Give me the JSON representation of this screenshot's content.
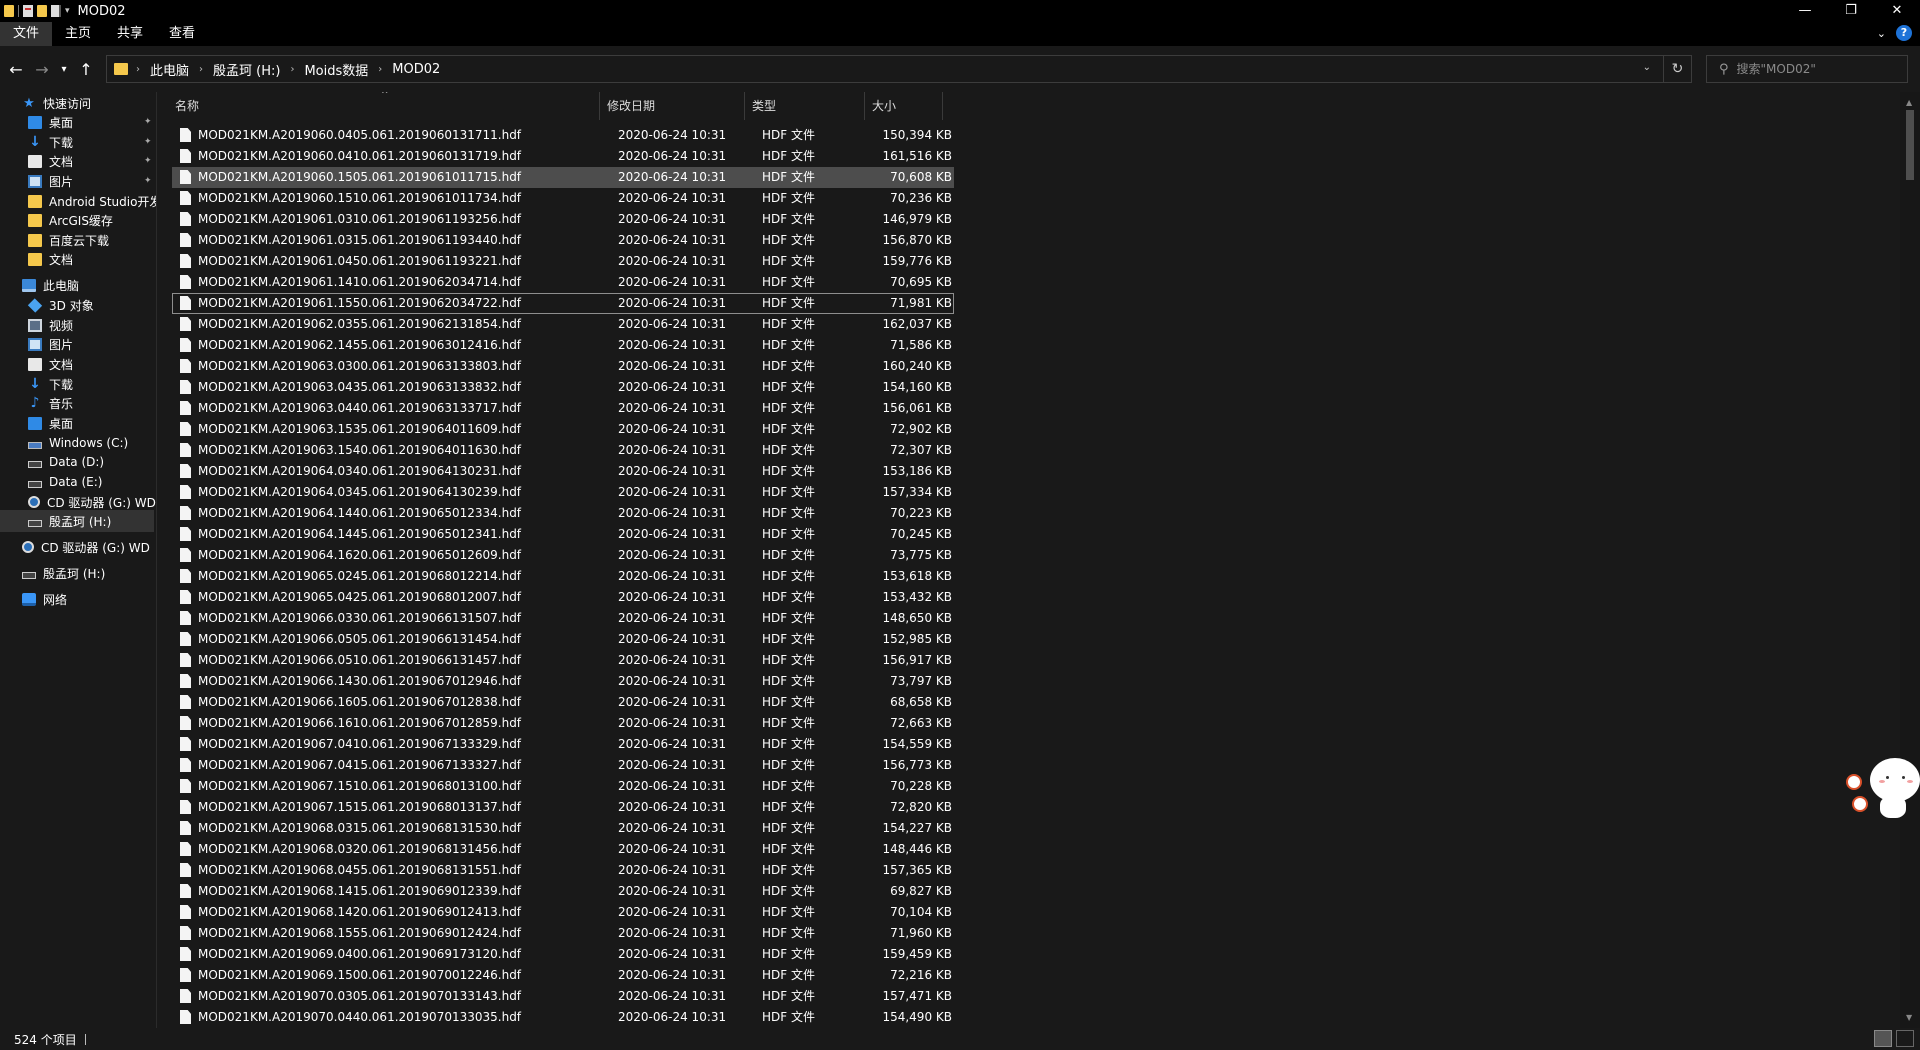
{
  "window": {
    "title": "MOD02",
    "controls": {
      "minimize": "—",
      "maximize": "❐",
      "close": "✕"
    }
  },
  "ribbon": {
    "tabs": [
      "文件",
      "主页",
      "共享",
      "查看"
    ],
    "expand_icon": "chevron-down-icon",
    "help_label": "?"
  },
  "address": {
    "crumbs": [
      "此电脑",
      "殷孟珂 (H:)",
      "Moids数据",
      "MOD02"
    ],
    "separator": "›",
    "search_placeholder": "搜索\"MOD02\""
  },
  "sidebar": {
    "items": [
      {
        "label": "快速访问",
        "icon": "star-icon",
        "indent": 1,
        "pinned": false
      },
      {
        "label": "桌面",
        "icon": "desktop-icon",
        "indent": 2,
        "pinned": true
      },
      {
        "label": "下载",
        "icon": "download-icon",
        "indent": 2,
        "pinned": true
      },
      {
        "label": "文档",
        "icon": "document-icon",
        "indent": 2,
        "pinned": true
      },
      {
        "label": "图片",
        "icon": "pictures-icon",
        "indent": 2,
        "pinned": true
      },
      {
        "label": "Android Studio开发",
        "icon": "folder-icon",
        "indent": 2,
        "pinned": false
      },
      {
        "label": "ArcGIS缓存",
        "icon": "folder-icon",
        "indent": 2,
        "pinned": false
      },
      {
        "label": "百度云下载",
        "icon": "folder-icon",
        "indent": 2,
        "pinned": false
      },
      {
        "label": "文档",
        "icon": "folder-icon",
        "indent": 2,
        "pinned": false
      },
      {
        "label": "此电脑",
        "icon": "computer-icon",
        "indent": 1,
        "pinned": false
      },
      {
        "label": "3D 对象",
        "icon": "3d-objects-icon",
        "indent": 2,
        "pinned": false
      },
      {
        "label": "视频",
        "icon": "video-icon",
        "indent": 2,
        "pinned": false
      },
      {
        "label": "图片",
        "icon": "pictures-icon",
        "indent": 2,
        "pinned": false
      },
      {
        "label": "文档",
        "icon": "document-icon",
        "indent": 2,
        "pinned": false
      },
      {
        "label": "下载",
        "icon": "download-icon",
        "indent": 2,
        "pinned": false
      },
      {
        "label": "音乐",
        "icon": "music-icon",
        "indent": 2,
        "pinned": false
      },
      {
        "label": "桌面",
        "icon": "desktop-icon",
        "indent": 2,
        "pinned": false
      },
      {
        "label": "Windows (C:)",
        "icon": "windows-drive-icon",
        "indent": 2,
        "pinned": false
      },
      {
        "label": "Data (D:)",
        "icon": "drive-icon",
        "indent": 2,
        "pinned": false
      },
      {
        "label": "Data (E:)",
        "icon": "drive-icon",
        "indent": 2,
        "pinned": false
      },
      {
        "label": "CD 驱动器 (G:) WD",
        "icon": "cd-drive-icon",
        "indent": 2,
        "pinned": false
      },
      {
        "label": "殷孟珂 (H:)",
        "icon": "drive-icon",
        "indent": 2,
        "pinned": false,
        "selected": true
      },
      {
        "label": "CD 驱动器 (G:) WD",
        "icon": "cd-drive-icon",
        "indent": 1,
        "pinned": false
      },
      {
        "label": "殷孟珂 (H:)",
        "icon": "drive-icon",
        "indent": 1,
        "pinned": false
      },
      {
        "label": "网络",
        "icon": "network-icon",
        "indent": 1,
        "pinned": false
      }
    ]
  },
  "columns": {
    "name": "名称",
    "date": "修改日期",
    "type": "类型",
    "size": "大小"
  },
  "files": [
    {
      "name": "MOD021KM.A2019060.0405.061.2019060131711.hdf",
      "date": "2020-06-24 10:31",
      "type": "HDF 文件",
      "size": "150,394 KB"
    },
    {
      "name": "MOD021KM.A2019060.0410.061.2019060131719.hdf",
      "date": "2020-06-24 10:31",
      "type": "HDF 文件",
      "size": "161,516 KB"
    },
    {
      "name": "MOD021KM.A2019060.1505.061.2019061011715.hdf",
      "date": "2020-06-24 10:31",
      "type": "HDF 文件",
      "size": "70,608 KB",
      "selected": true
    },
    {
      "name": "MOD021KM.A2019060.1510.061.2019061011734.hdf",
      "date": "2020-06-24 10:31",
      "type": "HDF 文件",
      "size": "70,236 KB"
    },
    {
      "name": "MOD021KM.A2019061.0310.061.2019061193256.hdf",
      "date": "2020-06-24 10:31",
      "type": "HDF 文件",
      "size": "146,979 KB"
    },
    {
      "name": "MOD021KM.A2019061.0315.061.2019061193440.hdf",
      "date": "2020-06-24 10:31",
      "type": "HDF 文件",
      "size": "156,870 KB"
    },
    {
      "name": "MOD021KM.A2019061.0450.061.2019061193221.hdf",
      "date": "2020-06-24 10:31",
      "type": "HDF 文件",
      "size": "159,776 KB"
    },
    {
      "name": "MOD021KM.A2019061.1410.061.2019062034714.hdf",
      "date": "2020-06-24 10:31",
      "type": "HDF 文件",
      "size": "70,695 KB"
    },
    {
      "name": "MOD021KM.A2019061.1550.061.2019062034722.hdf",
      "date": "2020-06-24 10:31",
      "type": "HDF 文件",
      "size": "71,981 KB",
      "focused": true
    },
    {
      "name": "MOD021KM.A2019062.0355.061.2019062131854.hdf",
      "date": "2020-06-24 10:31",
      "type": "HDF 文件",
      "size": "162,037 KB"
    },
    {
      "name": "MOD021KM.A2019062.1455.061.2019063012416.hdf",
      "date": "2020-06-24 10:31",
      "type": "HDF 文件",
      "size": "71,586 KB"
    },
    {
      "name": "MOD021KM.A2019063.0300.061.2019063133803.hdf",
      "date": "2020-06-24 10:31",
      "type": "HDF 文件",
      "size": "160,240 KB"
    },
    {
      "name": "MOD021KM.A2019063.0435.061.2019063133832.hdf",
      "date": "2020-06-24 10:31",
      "type": "HDF 文件",
      "size": "154,160 KB"
    },
    {
      "name": "MOD021KM.A2019063.0440.061.2019063133717.hdf",
      "date": "2020-06-24 10:31",
      "type": "HDF 文件",
      "size": "156,061 KB"
    },
    {
      "name": "MOD021KM.A2019063.1535.061.2019064011609.hdf",
      "date": "2020-06-24 10:31",
      "type": "HDF 文件",
      "size": "72,902 KB"
    },
    {
      "name": "MOD021KM.A2019063.1540.061.2019064011630.hdf",
      "date": "2020-06-24 10:31",
      "type": "HDF 文件",
      "size": "72,307 KB"
    },
    {
      "name": "MOD021KM.A2019064.0340.061.2019064130231.hdf",
      "date": "2020-06-24 10:31",
      "type": "HDF 文件",
      "size": "153,186 KB"
    },
    {
      "name": "MOD021KM.A2019064.0345.061.2019064130239.hdf",
      "date": "2020-06-24 10:31",
      "type": "HDF 文件",
      "size": "157,334 KB"
    },
    {
      "name": "MOD021KM.A2019064.1440.061.2019065012334.hdf",
      "date": "2020-06-24 10:31",
      "type": "HDF 文件",
      "size": "70,223 KB"
    },
    {
      "name": "MOD021KM.A2019064.1445.061.2019065012341.hdf",
      "date": "2020-06-24 10:31",
      "type": "HDF 文件",
      "size": "70,245 KB"
    },
    {
      "name": "MOD021KM.A2019064.1620.061.2019065012609.hdf",
      "date": "2020-06-24 10:31",
      "type": "HDF 文件",
      "size": "73,775 KB"
    },
    {
      "name": "MOD021KM.A2019065.0245.061.2019068012214.hdf",
      "date": "2020-06-24 10:31",
      "type": "HDF 文件",
      "size": "153,618 KB"
    },
    {
      "name": "MOD021KM.A2019065.0425.061.2019068012007.hdf",
      "date": "2020-06-24 10:31",
      "type": "HDF 文件",
      "size": "153,432 KB"
    },
    {
      "name": "MOD021KM.A2019066.0330.061.2019066131507.hdf",
      "date": "2020-06-24 10:31",
      "type": "HDF 文件",
      "size": "148,650 KB"
    },
    {
      "name": "MOD021KM.A2019066.0505.061.2019066131454.hdf",
      "date": "2020-06-24 10:31",
      "type": "HDF 文件",
      "size": "152,985 KB"
    },
    {
      "name": "MOD021KM.A2019066.0510.061.2019066131457.hdf",
      "date": "2020-06-24 10:31",
      "type": "HDF 文件",
      "size": "156,917 KB"
    },
    {
      "name": "MOD021KM.A2019066.1430.061.2019067012946.hdf",
      "date": "2020-06-24 10:31",
      "type": "HDF 文件",
      "size": "73,797 KB"
    },
    {
      "name": "MOD021KM.A2019066.1605.061.2019067012838.hdf",
      "date": "2020-06-24 10:31",
      "type": "HDF 文件",
      "size": "68,658 KB"
    },
    {
      "name": "MOD021KM.A2019066.1610.061.2019067012859.hdf",
      "date": "2020-06-24 10:31",
      "type": "HDF 文件",
      "size": "72,663 KB"
    },
    {
      "name": "MOD021KM.A2019067.0410.061.2019067133329.hdf",
      "date": "2020-06-24 10:31",
      "type": "HDF 文件",
      "size": "154,559 KB"
    },
    {
      "name": "MOD021KM.A2019067.0415.061.2019067133327.hdf",
      "date": "2020-06-24 10:31",
      "type": "HDF 文件",
      "size": "156,773 KB"
    },
    {
      "name": "MOD021KM.A2019067.1510.061.2019068013100.hdf",
      "date": "2020-06-24 10:31",
      "type": "HDF 文件",
      "size": "70,228 KB"
    },
    {
      "name": "MOD021KM.A2019067.1515.061.2019068013137.hdf",
      "date": "2020-06-24 10:31",
      "type": "HDF 文件",
      "size": "72,820 KB"
    },
    {
      "name": "MOD021KM.A2019068.0315.061.2019068131530.hdf",
      "date": "2020-06-24 10:31",
      "type": "HDF 文件",
      "size": "154,227 KB"
    },
    {
      "name": "MOD021KM.A2019068.0320.061.2019068131456.hdf",
      "date": "2020-06-24 10:31",
      "type": "HDF 文件",
      "size": "148,446 KB"
    },
    {
      "name": "MOD021KM.A2019068.0455.061.2019068131551.hdf",
      "date": "2020-06-24 10:31",
      "type": "HDF 文件",
      "size": "157,365 KB"
    },
    {
      "name": "MOD021KM.A2019068.1415.061.2019069012339.hdf",
      "date": "2020-06-24 10:31",
      "type": "HDF 文件",
      "size": "69,827 KB"
    },
    {
      "name": "MOD021KM.A2019068.1420.061.2019069012413.hdf",
      "date": "2020-06-24 10:31",
      "type": "HDF 文件",
      "size": "70,104 KB"
    },
    {
      "name": "MOD021KM.A2019068.1555.061.2019069012424.hdf",
      "date": "2020-06-24 10:31",
      "type": "HDF 文件",
      "size": "71,960 KB"
    },
    {
      "name": "MOD021KM.A2019069.0400.061.2019069173120.hdf",
      "date": "2020-06-24 10:31",
      "type": "HDF 文件",
      "size": "159,459 KB"
    },
    {
      "name": "MOD021KM.A2019069.1500.061.2019070012246.hdf",
      "date": "2020-06-24 10:31",
      "type": "HDF 文件",
      "size": "72,216 KB"
    },
    {
      "name": "MOD021KM.A2019070.0305.061.2019070133143.hdf",
      "date": "2020-06-24 10:31",
      "type": "HDF 文件",
      "size": "157,471 KB"
    },
    {
      "name": "MOD021KM.A2019070.0440.061.2019070133035.hdf",
      "date": "2020-06-24 10:31",
      "type": "HDF 文件",
      "size": "154,490 KB"
    }
  ],
  "status": {
    "item_count": "524 个项目"
  },
  "colors": {
    "background": "#191919",
    "chrome": "#000000",
    "selection": "#4d4d4d",
    "accent": "#3a96f7",
    "folder": "#f5c84c"
  }
}
